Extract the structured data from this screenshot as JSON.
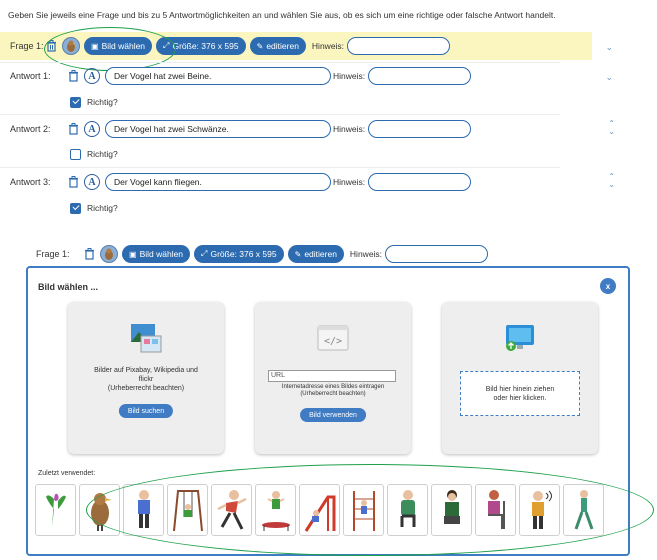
{
  "intro": "Geben Sie jeweils eine Frage und bis zu 5 Antwortmöglichkeiten an und wählen Sie aus, ob es sich um eine richtige oder falsche Antwort handelt.",
  "question": {
    "label": "Frage 1:",
    "image_button": "Bild wählen",
    "size_button": "Größe: 376 x 595",
    "edit_button": "editieren",
    "hint_label": "Hinweis:",
    "hint_value": ""
  },
  "answers": [
    {
      "label": "Antwort 1:",
      "value": "Der Vogel hat zwei Beine.",
      "hint_label": "Hinweis:",
      "correct_label": "Richtig?",
      "correct": true
    },
    {
      "label": "Antwort 2:",
      "value": "Der Vogel hat zwei Schwänze.",
      "hint_label": "Hinweis:",
      "correct_label": "Richtig?",
      "correct": false
    },
    {
      "label": "Antwort 3:",
      "value": "Der Vogel kann fliegen.",
      "hint_label": "Hinweis:",
      "correct_label": "Richtig?",
      "correct": true
    }
  ],
  "question2": {
    "label": "Frage 1:",
    "image_button": "Bild wählen",
    "size_button": "Größe: 376 x 595",
    "edit_button": "editieren",
    "hint_label": "Hinweis:"
  },
  "dialog": {
    "title": "Bild wählen ...",
    "close": "x",
    "card_search": {
      "text": "Bilder auf Pixabay, Wikipedia und flickr\n(Urheberrecht beachten)",
      "line1": "Bilder auf Pixabay, Wikipedia und",
      "line2": "flickr",
      "line3": "(Urheberrecht beachten)",
      "button": "Bild suchen"
    },
    "card_url": {
      "placeholder": "URL",
      "line1": "Internetadresse eines Bildes eintragen",
      "line2": "(Urheberrecht beachten)",
      "button": "Bild verwenden"
    },
    "card_drop": {
      "line1": "Bild hier hinein ziehen",
      "line2": "oder hier klicken."
    },
    "recent_label": "Zuletzt verwendet:",
    "recent_icons": [
      "plant-icon",
      "bird-icon",
      "standing-person-icon",
      "swing-icon",
      "running-person-icon",
      "trampoline-icon",
      "slide-icon",
      "climbing-frame-icon",
      "sitting-person-icon",
      "sitting-child-icon",
      "woman-chair-icon",
      "calling-person-icon",
      "walking-person-icon"
    ]
  },
  "colors": {
    "accent": "#2d6bb0",
    "highlight": "#fbf6bf",
    "annotation": "#1ea04a"
  }
}
